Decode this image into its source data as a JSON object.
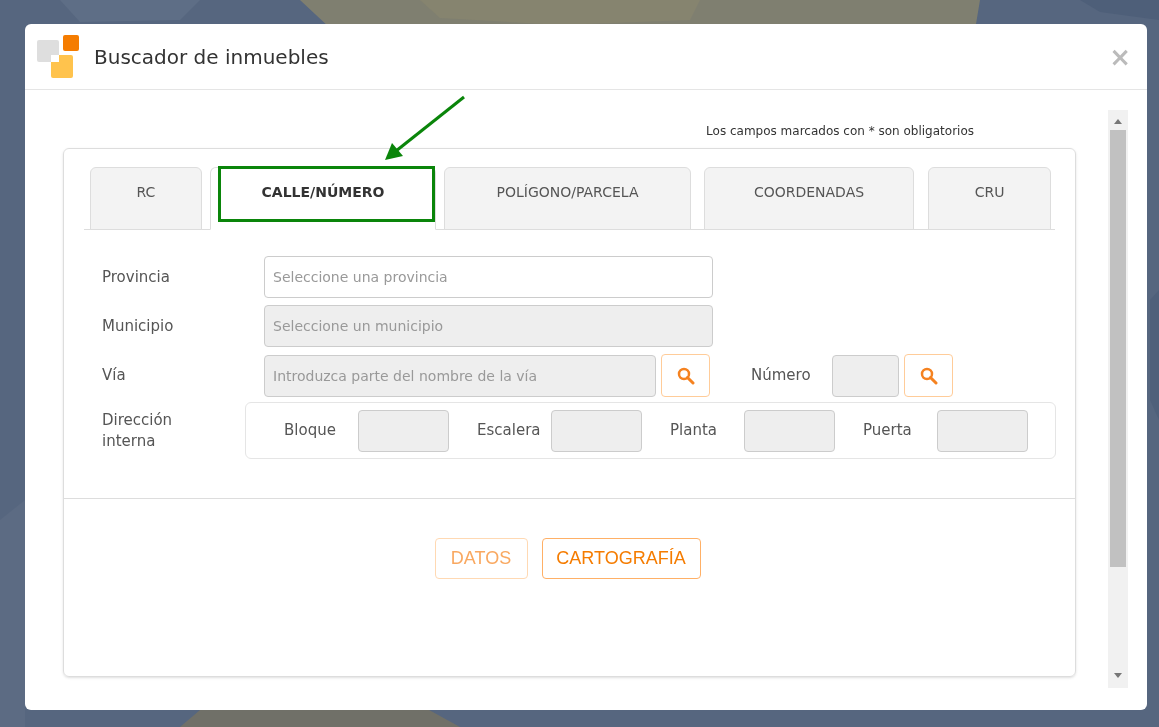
{
  "window": {
    "title": "Buscador de inmuebles",
    "close": "×"
  },
  "note": "Los campos marcados con * son obligatorios",
  "tabs": [
    {
      "label": "RC",
      "selected": false
    },
    {
      "label": "CALLE/NÚMERO",
      "selected": true
    },
    {
      "label": "POLÍGONO/PARCELA",
      "selected": false
    },
    {
      "label": "COORDENADAS",
      "selected": false
    },
    {
      "label": "CRU",
      "selected": false
    }
  ],
  "fields": [
    {
      "label": "Provincia",
      "placeholder": "Seleccione una provincia",
      "disabled": false,
      "search": false
    },
    {
      "label": "Municipio",
      "placeholder": "Seleccione un municipio",
      "disabled": true,
      "search": false
    },
    {
      "label": "Vía",
      "placeholder": "Introduzca parte del nombre de la vía",
      "disabled": true,
      "search": true
    }
  ],
  "numero": {
    "label": "Número",
    "disabled": true,
    "search": true
  },
  "internal_address": {
    "label": "Dirección interna",
    "fields": [
      {
        "label": "Bloque",
        "disabled": true
      },
      {
        "label": "Escalera",
        "disabled": true
      },
      {
        "label": "Planta",
        "disabled": true
      },
      {
        "label": "Puerta",
        "disabled": true
      }
    ]
  },
  "buttons": [
    {
      "label": "DATOS",
      "disabled": true
    },
    {
      "label": "CARTOGRAFÍA",
      "disabled": false
    }
  ]
}
